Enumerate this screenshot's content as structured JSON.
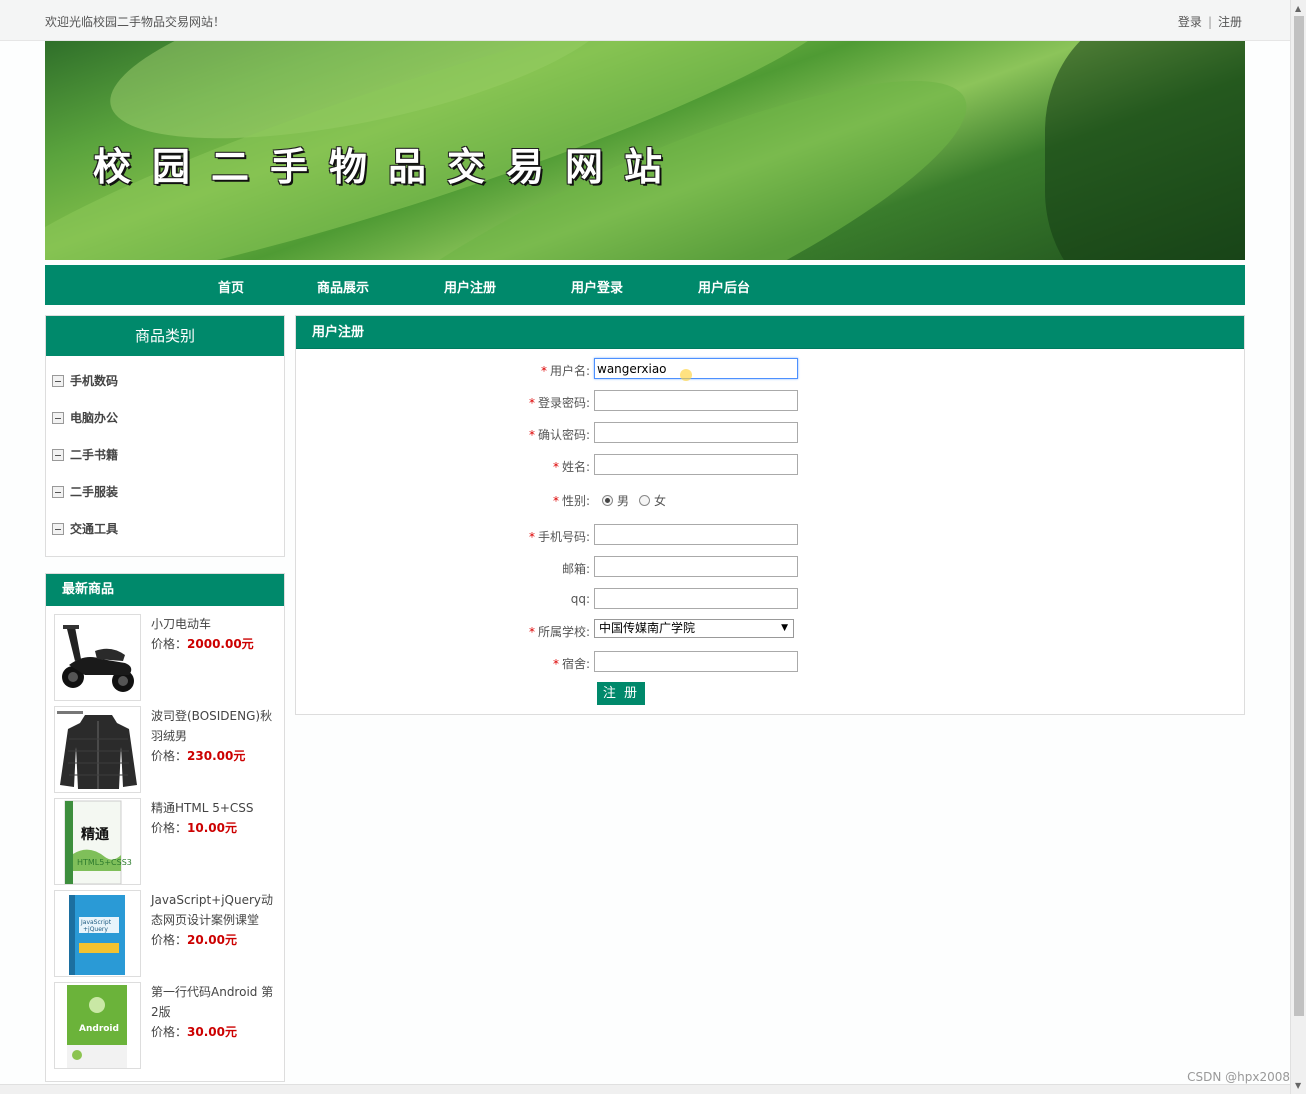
{
  "topbar": {
    "welcome": "欢迎光临校园二手物品交易网站！",
    "login": "登录",
    "sep": "|",
    "register": "注册"
  },
  "banner": {
    "title": "校园二手物品交易网站"
  },
  "nav": {
    "items": [
      "首页",
      "商品展示",
      "用户注册",
      "用户登录",
      "用户后台"
    ]
  },
  "categories": {
    "title": "商品类别",
    "items": [
      "手机数码",
      "电脑办公",
      "二手书籍",
      "二手服装",
      "交通工具"
    ]
  },
  "latest": {
    "title": "最新商品",
    "price_label": "价格：",
    "products": [
      {
        "name": "小刀电动车",
        "price": "2000.00元"
      },
      {
        "name": "波司登(BOSIDENG)秋羽绒男",
        "price": "230.00元"
      },
      {
        "name": "精通HTML 5+CSS",
        "price": "10.00元"
      },
      {
        "name": "JavaScript+jQuery动态网页设计案例课堂",
        "price": "20.00元"
      },
      {
        "name": "第一行代码Android 第2版",
        "price": "30.00元"
      }
    ]
  },
  "form": {
    "title": "用户注册",
    "username": {
      "label": "用户名:",
      "value": "wangerxiao"
    },
    "password": {
      "label": "登录密码:",
      "value": ""
    },
    "confirm": {
      "label": "确认密码:",
      "value": ""
    },
    "name": {
      "label": "姓名:",
      "value": ""
    },
    "gender": {
      "label": "性别:",
      "male": "男",
      "female": "女",
      "selected": "男"
    },
    "phone": {
      "label": "手机号码:",
      "value": ""
    },
    "email": {
      "label": "邮箱:",
      "value": ""
    },
    "qq": {
      "label": "qq:",
      "value": ""
    },
    "school": {
      "label": "所属学校:",
      "value": "中国传媒南广学院"
    },
    "dorm": {
      "label": "宿舍:",
      "value": ""
    },
    "required_mark": "*",
    "submit": "注 册"
  },
  "watermark": "CSDN @hpx2008",
  "colors": {
    "accent": "#00896b",
    "price": "#cc0000"
  }
}
